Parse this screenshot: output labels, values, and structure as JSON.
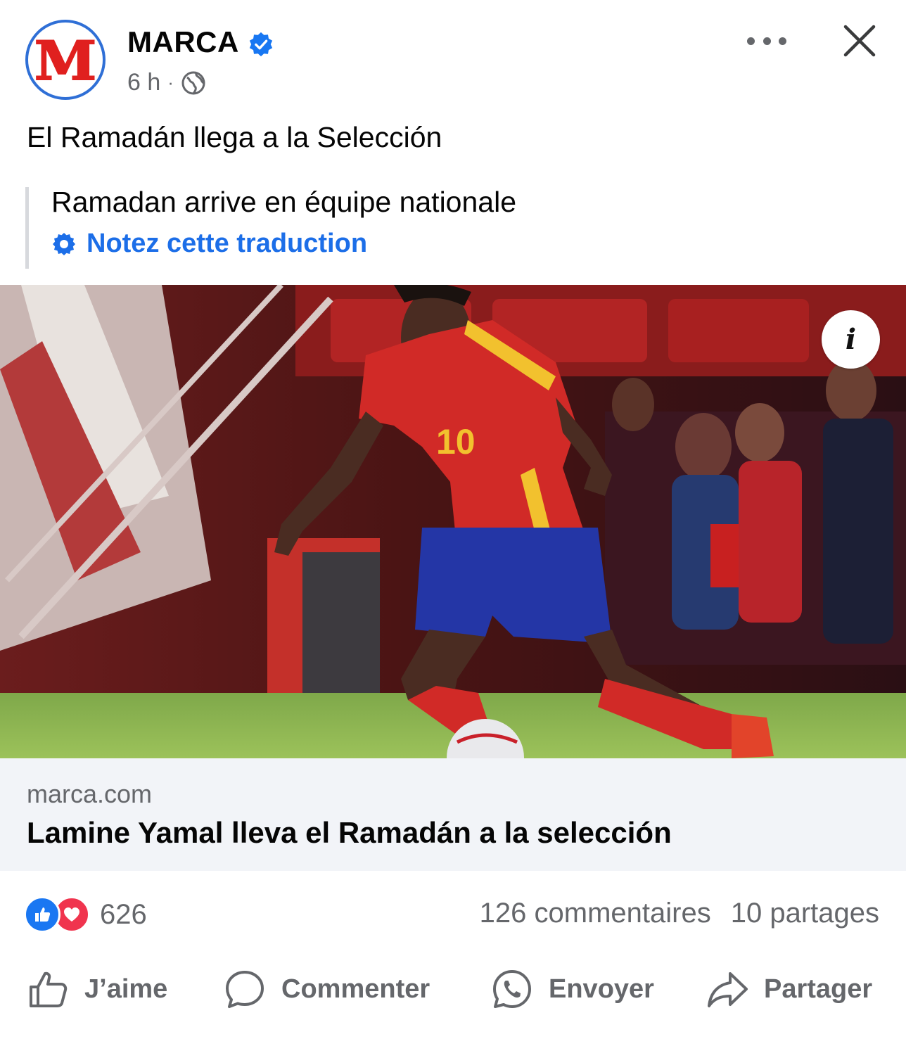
{
  "post": {
    "page_name": "MARCA",
    "avatar_letter": "M",
    "time": "6 h",
    "separator": "·",
    "text": "El Ramadán llega a la Selección",
    "translation": "Ramadan arrive en équipe nationale",
    "rate_translation_label": "Notez cette traduction"
  },
  "link": {
    "domain": "marca.com",
    "headline": "Lamine Yamal lleva el Ramadán a la selección",
    "info_button": "i"
  },
  "stats": {
    "reaction_count": "626",
    "comments": "126 commentaires",
    "shares": "10 partages"
  },
  "actions": {
    "like": "J’aime",
    "comment": "Commenter",
    "send": "Envoyer",
    "share": "Partager"
  },
  "colors": {
    "accent_blue": "#1c6ee8",
    "marca_red": "#e0201f",
    "muted": "#65676b",
    "link_card_bg": "#f2f4f8"
  },
  "icons": [
    "verified-badge-icon",
    "globe-icon",
    "more-icon",
    "close-icon",
    "gear-icon",
    "info-icon",
    "like-reaction-icon",
    "love-reaction-icon",
    "thumbs-up-icon",
    "comment-icon",
    "whatsapp-icon",
    "share-icon"
  ]
}
